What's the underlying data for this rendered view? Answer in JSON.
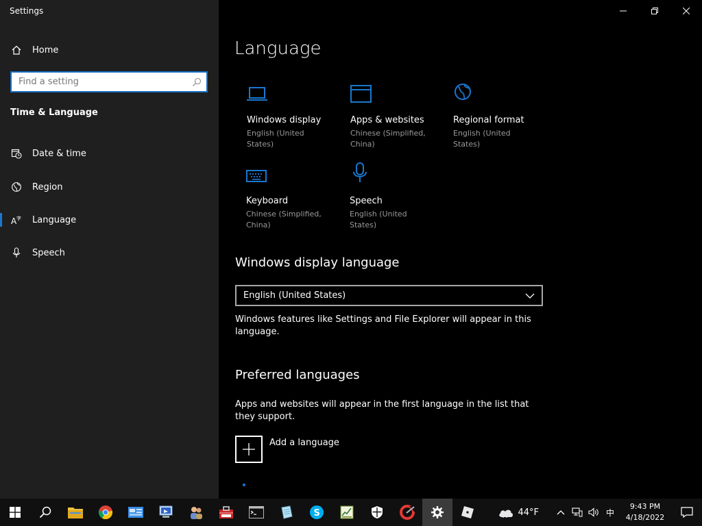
{
  "window": {
    "title": "Settings",
    "controls": [
      "minimize-icon",
      "restore-icon",
      "close-icon"
    ]
  },
  "sidebar": {
    "home_label": "Home",
    "search": {
      "placeholder": "Find a setting",
      "value": ""
    },
    "section_title": "Time & Language",
    "items": [
      {
        "label": "Date & time",
        "icon": "calendar-clock-icon",
        "active": false
      },
      {
        "label": "Region",
        "icon": "globe-icon",
        "active": false
      },
      {
        "label": "Language",
        "icon": "language-icon",
        "active": true
      },
      {
        "label": "Speech",
        "icon": "microphone-icon",
        "active": false
      }
    ]
  },
  "main": {
    "title": "Language",
    "tiles": [
      {
        "name": "Windows display",
        "sub": "English (United States)",
        "icon": "laptop-icon"
      },
      {
        "name": "Apps & websites",
        "sub": "Chinese (Simplified, China)",
        "icon": "browser-window-icon"
      },
      {
        "name": "Regional format",
        "sub": "English (United States)",
        "icon": "globe-icon"
      },
      {
        "name": "Keyboard",
        "sub": "Chinese (Simplified, China)",
        "icon": "keyboard-icon"
      },
      {
        "name": "Speech",
        "sub": "English (United States)",
        "icon": "microphone-icon"
      }
    ],
    "display_language": {
      "heading": "Windows display language",
      "selected": "English (United States)",
      "description": "Windows features like Settings and File Explorer will appear in this language."
    },
    "preferred": {
      "heading": "Preferred languages",
      "description": "Apps and websites will appear in the first language in the list that they support.",
      "add_label": "Add a language"
    }
  },
  "taskbar": {
    "apps": [
      "start-icon",
      "search-icon",
      "file-explorer-icon",
      "chrome-icon",
      "control-panel-icon",
      "remote-desktop-icon",
      "users-icon",
      "toolbox-icon",
      "command-prompt-icon",
      "notepad-icon",
      "skype-icon",
      "spreadsheet-icon",
      "security-shield-icon",
      "ccleaner-icon",
      "settings-gear-icon",
      "roblox-icon"
    ],
    "weather": {
      "temp": "44°F",
      "icon": "cloud-icon"
    },
    "ime": "中",
    "clock": {
      "time": "9:43 PM",
      "date": "4/18/2022"
    }
  },
  "colors": {
    "accent": "#1a78d0",
    "sidebar_bg": "#1f1f1f",
    "main_bg": "#000000",
    "secondary_text": "#9a9a9a"
  }
}
